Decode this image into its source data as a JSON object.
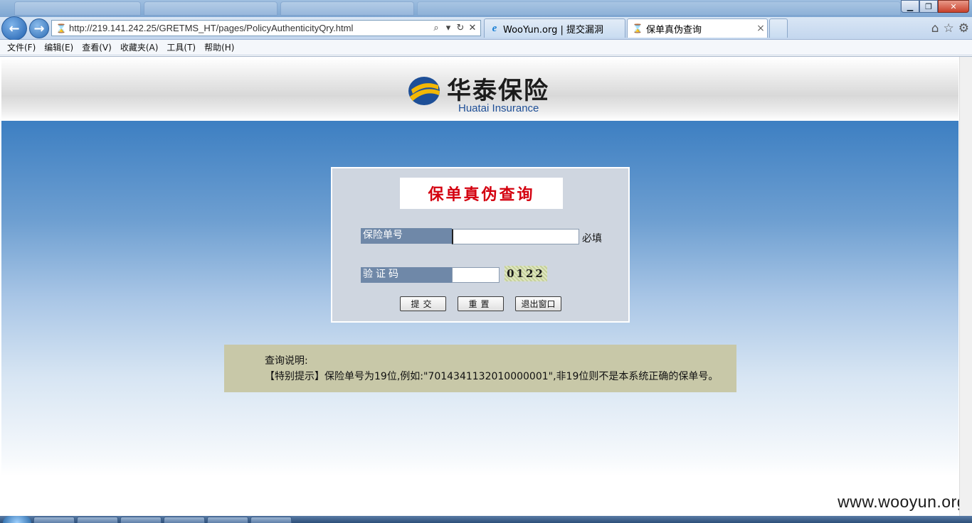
{
  "browser": {
    "address_url": "http://219.141.242.25/GRETMS_HT/pages/PolicyAuthenticityQry.html",
    "tabs": [
      {
        "label": "WooYun.org | 提交漏洞",
        "icon": "ie-icon"
      },
      {
        "label": "保单真伪查询",
        "icon": "loading-icon"
      }
    ],
    "window_buttons": {
      "minimize": "▁",
      "maximize": "❐",
      "close": "✕"
    },
    "address_tools": {
      "search": "⌕",
      "compat": "▾",
      "refresh": "↻",
      "stop": "✕"
    },
    "right_icons": {
      "home": "⌂",
      "favorites": "☆",
      "tools": "⚙"
    }
  },
  "menu": [
    "文件(F)",
    "编辑(E)",
    "查看(V)",
    "收藏夹(A)",
    "工具(T)",
    "帮助(H)"
  ],
  "header": {
    "logo_cn": "华泰保险",
    "logo_en": "Huatai Insurance"
  },
  "form": {
    "title": "保单真伪查询",
    "policy_label": "保险单号",
    "policy_value": "",
    "required_text": "必填",
    "captcha_label": "验证码",
    "captcha_value": "",
    "captcha_code": "0122",
    "submit_label": "提交",
    "reset_label": "重置",
    "exit_label": "退出窗口"
  },
  "notice": {
    "title": "查询说明:",
    "text": "【特别提示】保险单号为19位,例如:\"7014341132010000001\",非19位则不是本系统正确的保单号。"
  },
  "watermark": "www.wooyun.org",
  "colors": {
    "title_red": "#d4000f",
    "label_bg": "#6f88a8",
    "panel_bg": "#cfd6e0",
    "notice_bg": "#c8c8a8",
    "logo_blue": "#1e4f97",
    "logo_yellow": "#f2b705"
  }
}
